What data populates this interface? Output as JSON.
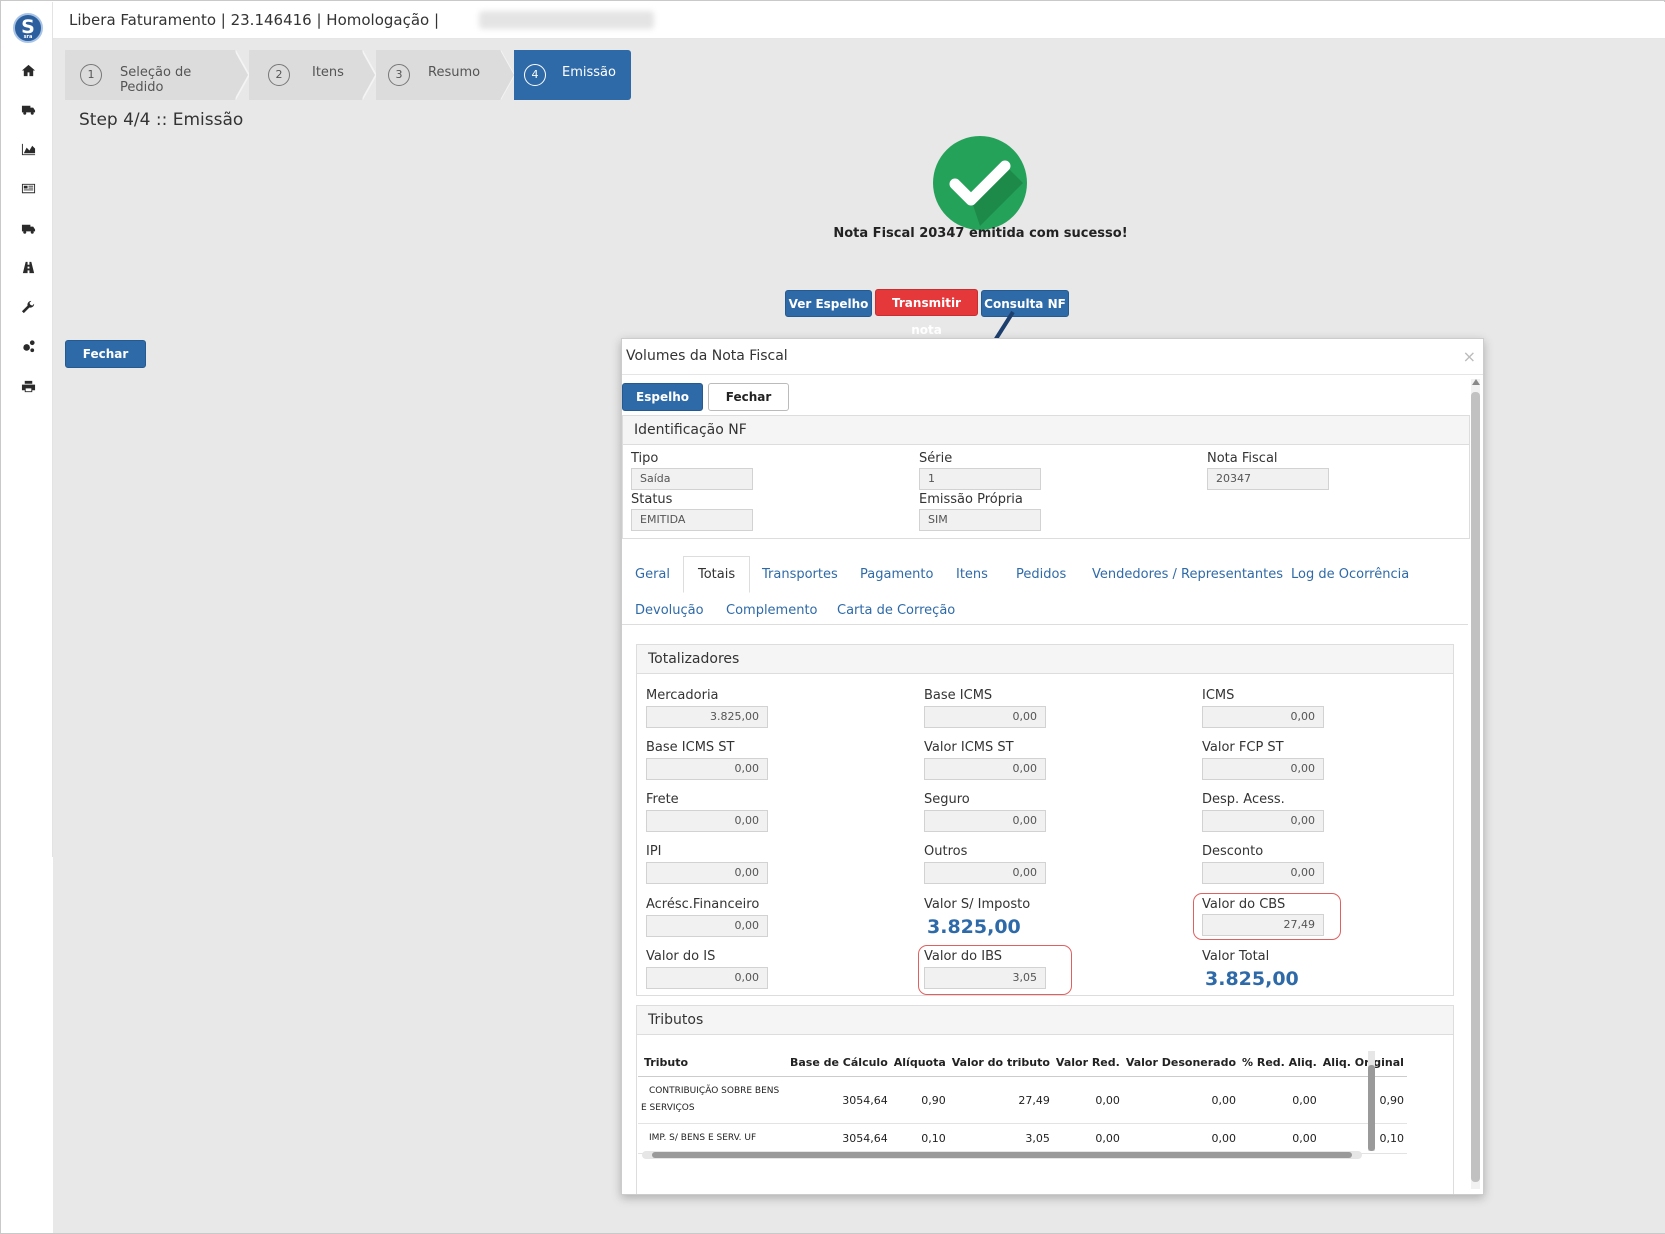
{
  "header": {
    "title": "Libera Faturamento | 23.146416 | Homologação |"
  },
  "sidebar": {
    "logo_letter": "S",
    "logo_sub": "sra",
    "icons": [
      "home-icon",
      "truck-icon",
      "area-chart-icon",
      "newspaper-icon",
      "truck-icon",
      "road-icon",
      "wrench-icon",
      "cogs-icon",
      "print-icon"
    ]
  },
  "wizard": {
    "steps": [
      {
        "num": "1",
        "label": "Seleção de Pedido"
      },
      {
        "num": "2",
        "label": "Itens"
      },
      {
        "num": "3",
        "label": "Resumo"
      },
      {
        "num": "4",
        "label": "Emissão"
      }
    ],
    "active_index": 3,
    "title": "Step 4/4 :: Emissão"
  },
  "success": {
    "message": "Nota Fiscal 20347 emitida com sucesso!"
  },
  "actions": {
    "ver_espelho": "Ver Espelho",
    "transmitir": "Transmitir nota",
    "consulta": "Consulta NF",
    "fechar": "Fechar"
  },
  "modal": {
    "title": "Volumes da Nota Fiscal",
    "close": "×",
    "espelho": "Espelho",
    "fechar": "Fechar",
    "identificacao": {
      "heading": "Identificação NF",
      "tipo_label": "Tipo",
      "tipo": "Saída",
      "serie_label": "Série",
      "serie": "1",
      "nota_label": "Nota Fiscal",
      "nota": "20347",
      "status_label": "Status",
      "status": "EMITIDA",
      "emissao_label": "Emissão Própria",
      "emissao": "SIM"
    },
    "tabs": [
      "Geral",
      "Totais",
      "Transportes",
      "Pagamento",
      "Itens",
      "Pedidos",
      "Vendedores / Representantes",
      "Log de Ocorrência",
      "Devolução",
      "Complemento",
      "Carta de Correção"
    ],
    "active_tab": "Totais",
    "totalizadores": {
      "heading": "Totalizadores",
      "mercadoria_label": "Mercadoria",
      "mercadoria": "3.825,00",
      "base_icms_label": "Base ICMS",
      "base_icms": "0,00",
      "icms_label": "ICMS",
      "icms": "0,00",
      "base_icms_st_label": "Base ICMS ST",
      "base_icms_st": "0,00",
      "valor_icms_st_label": "Valor ICMS ST",
      "valor_icms_st": "0,00",
      "valor_fcp_st_label": "Valor FCP ST",
      "valor_fcp_st": "0,00",
      "frete_label": "Frete",
      "frete": "0,00",
      "seguro_label": "Seguro",
      "seguro": "0,00",
      "desp_label": "Desp. Acess.",
      "desp": "0,00",
      "ipi_label": "IPI",
      "ipi": "0,00",
      "outros_label": "Outros",
      "outros": "0,00",
      "desconto_label": "Desconto",
      "desconto": "0,00",
      "acresc_label": "Acrésc.Financeiro",
      "acresc": "0,00",
      "valor_s_imposto_label": "Valor S/ Imposto",
      "valor_s_imposto": "3.825,00",
      "cbs_label": "Valor do CBS",
      "cbs": "27,49",
      "is_label": "Valor do IS",
      "is": "0,00",
      "ibs_label": "Valor do IBS",
      "ibs": "3,05",
      "valor_total_label": "Valor Total",
      "valor_total": "3.825,00"
    },
    "tributos": {
      "heading": "Tributos",
      "columns": [
        "Tributo",
        "Base de Cálculo",
        "Alíquota",
        "Valor do tributo",
        "Valor Red.",
        "Valor Desonerado",
        "% Red. Aliq.",
        "Aliq. Original"
      ],
      "rows": [
        [
          "CONTRIBUIÇÃO SOBRE BENS E SERVIÇOS",
          "3054,64",
          "0,90",
          "27,49",
          "0,00",
          "0,00",
          "0,00",
          "0,90"
        ],
        [
          "IMP. S/ BENS E SERV. UF",
          "3054,64",
          "0,10",
          "3,05",
          "0,00",
          "0,00",
          "0,00",
          "0,10"
        ]
      ]
    }
  },
  "colors": {
    "primary": "#2f6aa8",
    "danger": "#e5383b",
    "success": "#25a25a",
    "highlight": "#e06060"
  }
}
